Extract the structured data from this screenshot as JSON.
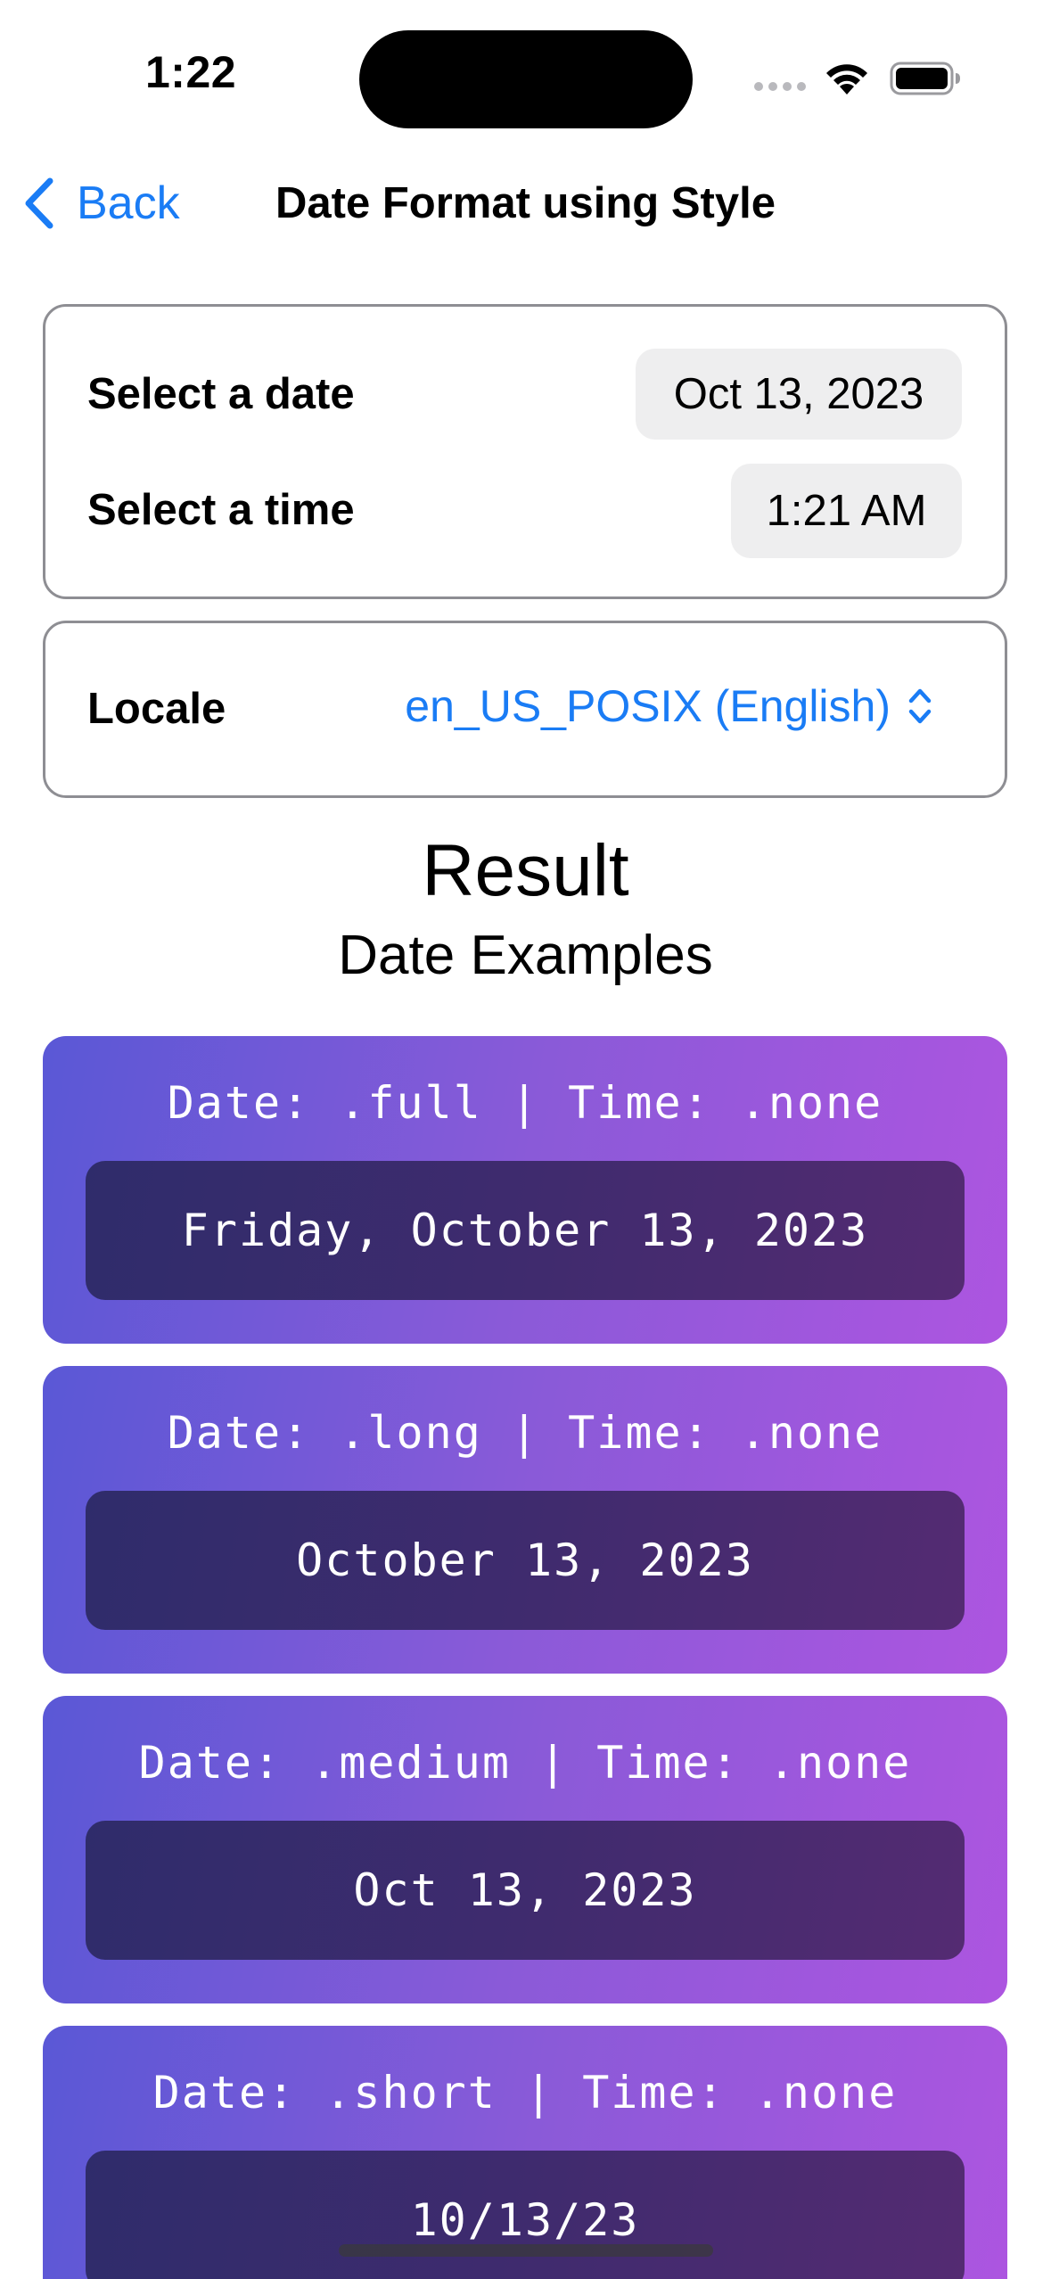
{
  "status_bar": {
    "time": "1:22"
  },
  "nav": {
    "back_label": "Back",
    "title": "Date Format using Style"
  },
  "date_time_card": {
    "date_label": "Select a date",
    "date_value": "Oct 13, 2023",
    "time_label": "Select a time",
    "time_value": "1:21 AM"
  },
  "locale_card": {
    "label": "Locale",
    "value": "en_US_POSIX (English)"
  },
  "result": {
    "title": "Result",
    "subtitle": "Date Examples"
  },
  "examples": [
    {
      "label": "Date: .full | Time: .none",
      "value": "Friday, October 13, 2023"
    },
    {
      "label": "Date: .long | Time: .none",
      "value": "October 13, 2023"
    },
    {
      "label": "Date: .medium | Time: .none",
      "value": "Oct 13, 2023"
    },
    {
      "label": "Date: .short | Time: .none",
      "value": "10/13/23"
    }
  ],
  "colors": {
    "accent": "#1a7cf5",
    "card_gradient_start": "#5a58d6",
    "card_gradient_end": "#ad55e0",
    "value_gradient_start": "#2f2c6b",
    "value_gradient_end": "#542b72"
  },
  "icons": {
    "back": "chevron-left-icon",
    "locale_picker": "chevron-up-down-icon",
    "wifi": "wifi-icon",
    "battery": "battery-icon",
    "signal": "cellular-signal-icon"
  }
}
